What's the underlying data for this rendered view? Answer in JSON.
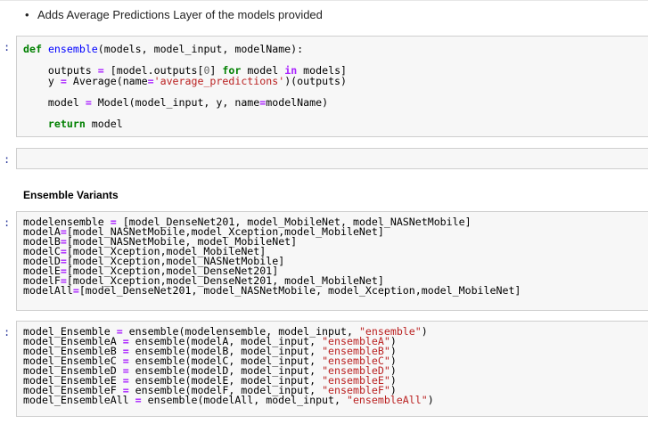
{
  "markdown": {
    "bullet": "Adds Average Predictions Layer of the models provided",
    "heading": "Ensemble Variants"
  },
  "prompts": {
    "p1": ":",
    "p2": ":",
    "p3": ":",
    "p4": ":"
  },
  "cell1": {
    "l1": {
      "kw": "def",
      "name": "ensemble",
      "rest": "(models, model_input, modelName):"
    },
    "l3": {
      "a": "outputs ",
      "eq": "=",
      "b": " [model.outputs[",
      "n": "0",
      "c": "] ",
      "for": "for",
      "d": " model ",
      "in": "in",
      "e": " models]"
    },
    "l4": {
      "a": "y ",
      "eq": "=",
      "b": " Average(name",
      "eq2": "=",
      "s": "'average_predictions'",
      "c": ")(outputs)"
    },
    "l6": {
      "a": "model ",
      "eq": "=",
      "b": " Model(model_input, y, name",
      "eq2": "=",
      "c": "modelName)"
    },
    "l8": {
      "kw": "return",
      "rest": " model"
    }
  },
  "cell3": [
    {
      "lhs": "modelensemble",
      "rhs": " [model_DenseNet201, model_MobileNet, model_NASNetMobile]"
    },
    {
      "lhs": "modelA",
      "rhs": "[model_NASNetMobile,model_Xception,model_MobileNet]"
    },
    {
      "lhs": "modelB",
      "rhs": "[model_NASNetMobile, model_MobileNet]"
    },
    {
      "lhs": "modelC",
      "rhs": "[model_Xception,model_MobileNet]"
    },
    {
      "lhs": "modelD",
      "rhs": "[model_Xception,model_NASNetMobile]"
    },
    {
      "lhs": "modelE",
      "rhs": "[model_Xception,model_DenseNet201]"
    },
    {
      "lhs": "modelF",
      "rhs": "[model_Xception,model_DenseNet201, model_MobileNet]"
    },
    {
      "lhs": "modelAll",
      "rhs": "[model_DenseNet201, model_NASNetMobile, model_Xception,model_MobileNet]"
    }
  ],
  "cell4": [
    {
      "lhs": "model_Ensemble ",
      "call": " ensemble(modelensemble, model_input, ",
      "str": "\"ensemble\"",
      "end": ")"
    },
    {
      "lhs": "model_EnsembleA ",
      "call": " ensemble(modelA, model_input, ",
      "str": "\"ensembleA\"",
      "end": ")"
    },
    {
      "lhs": "model_EnsembleB ",
      "call": " ensemble(modelB, model_input, ",
      "str": "\"ensembleB\"",
      "end": ")"
    },
    {
      "lhs": "model_EnsembleC ",
      "call": " ensemble(modelC, model_input, ",
      "str": "\"ensembleC\"",
      "end": ")"
    },
    {
      "lhs": "model_EnsembleD ",
      "call": " ensemble(modelD, model_input, ",
      "str": "\"ensembleD\"",
      "end": ")"
    },
    {
      "lhs": "model_EnsembleE ",
      "call": " ensemble(modelE, model_input, ",
      "str": "\"ensembleE\"",
      "end": ")"
    },
    {
      "lhs": "model_EnsembleF ",
      "call": " ensemble(modelF, model_input, ",
      "str": "\"ensembleF\"",
      "end": ")"
    },
    {
      "lhs": "model_EnsembleAll ",
      "call": " ensemble(modelAll, model_input, ",
      "str": "\"ensembleAll\"",
      "end": ")"
    }
  ]
}
